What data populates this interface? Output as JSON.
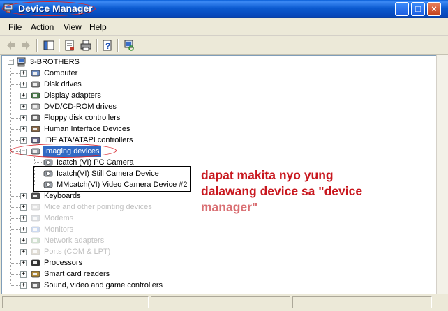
{
  "window": {
    "title": "Device Manager",
    "controls": {
      "minimize": "_",
      "maximize": "□",
      "close": "×"
    }
  },
  "menu": [
    "File",
    "Action",
    "View",
    "Help"
  ],
  "toolbar_icons": [
    "back-arrow-icon",
    "forward-arrow-icon",
    "show-hide-console-tree-icon",
    "properties-icon",
    "print-icon",
    "help-icon",
    "scan-hardware-icon"
  ],
  "tree": {
    "root": "3-BROTHERS",
    "items": [
      {
        "label": "Computer",
        "icon": "computer-icon"
      },
      {
        "label": "Disk drives",
        "icon": "disk-drive-icon"
      },
      {
        "label": "Display adapters",
        "icon": "display-adapter-icon"
      },
      {
        "label": "DVD/CD-ROM drives",
        "icon": "cdrom-icon"
      },
      {
        "label": "Floppy disk controllers",
        "icon": "floppy-controller-icon"
      },
      {
        "label": "Human Interface Devices",
        "icon": "hid-icon"
      },
      {
        "label": "IDE ATA/ATAPI controllers",
        "icon": "ide-controller-icon"
      },
      {
        "label": "Imaging devices",
        "icon": "camera-icon",
        "expanded": true,
        "selected": true,
        "children": [
          {
            "label": "Icatch (VI) PC Camera",
            "icon": "camera-icon"
          },
          {
            "label": "Icatch(VI) Still Camera Device",
            "icon": "camera-icon"
          },
          {
            "label": "MMcatch(VI) Video Camera Device #2",
            "icon": "camera-icon"
          }
        ]
      },
      {
        "label": "Keyboards",
        "icon": "keyboard-icon"
      },
      {
        "label": "Mice and other pointing devices",
        "icon": "mouse-icon"
      },
      {
        "label": "Modems",
        "icon": "modem-icon"
      },
      {
        "label": "Monitors",
        "icon": "monitor-icon"
      },
      {
        "label": "Network adapters",
        "icon": "network-adapter-icon"
      },
      {
        "label": "Ports (COM & LPT)",
        "icon": "port-icon"
      },
      {
        "label": "Processors",
        "icon": "processor-icon"
      },
      {
        "label": "Smart card readers",
        "icon": "smart-card-icon"
      },
      {
        "label": "Sound, video and game controllers",
        "icon": "sound-icon"
      }
    ]
  },
  "annotation": {
    "line1": "dapat makita nyo yung",
    "line2": "dalawang device sa \"device",
    "line3": "manager\""
  },
  "colors": {
    "title_bar": "#0a5fd8",
    "selection": "#316ac5",
    "annotation_red": "#c8171e",
    "highlight_oval": "#d7262c"
  }
}
